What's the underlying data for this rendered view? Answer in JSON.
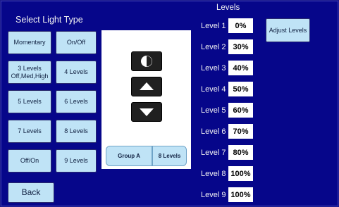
{
  "title": "Select Light Type",
  "type_buttons": [
    {
      "label": "Momentary"
    },
    {
      "label": "On/Off"
    },
    {
      "label": "3 Levels\nOff,Med,High"
    },
    {
      "label": "4 Levels"
    },
    {
      "label": "5 Levels"
    },
    {
      "label": "6 Levels"
    },
    {
      "label": "7 Levels"
    },
    {
      "label": "8 Levels"
    },
    {
      "label": "Off/On"
    },
    {
      "label": "9 Levels"
    }
  ],
  "back_label": "Back",
  "panel": {
    "icons": [
      "contrast-icon",
      "arrow-up-icon",
      "arrow-down-icon"
    ],
    "group_label": "Group A",
    "group_levels": "8 Levels"
  },
  "levels": {
    "heading": "Levels",
    "items": [
      {
        "label": "Level 1",
        "value": "0%"
      },
      {
        "label": "Level 2",
        "value": "30%"
      },
      {
        "label": "Level 3",
        "value": "40%"
      },
      {
        "label": "Level 4",
        "value": "50%"
      },
      {
        "label": "Level 5",
        "value": "60%"
      },
      {
        "label": "Level 6",
        "value": "70%"
      },
      {
        "label": "Level 7",
        "value": "80%"
      },
      {
        "label": "Level 8",
        "value": "100%"
      },
      {
        "label": "Level 9",
        "value": "100%"
      }
    ]
  },
  "adjust_label": "Adjust Levels",
  "colors": {
    "background": "#06068a",
    "button": "#bfe3f6",
    "icon_button": "#202020"
  }
}
